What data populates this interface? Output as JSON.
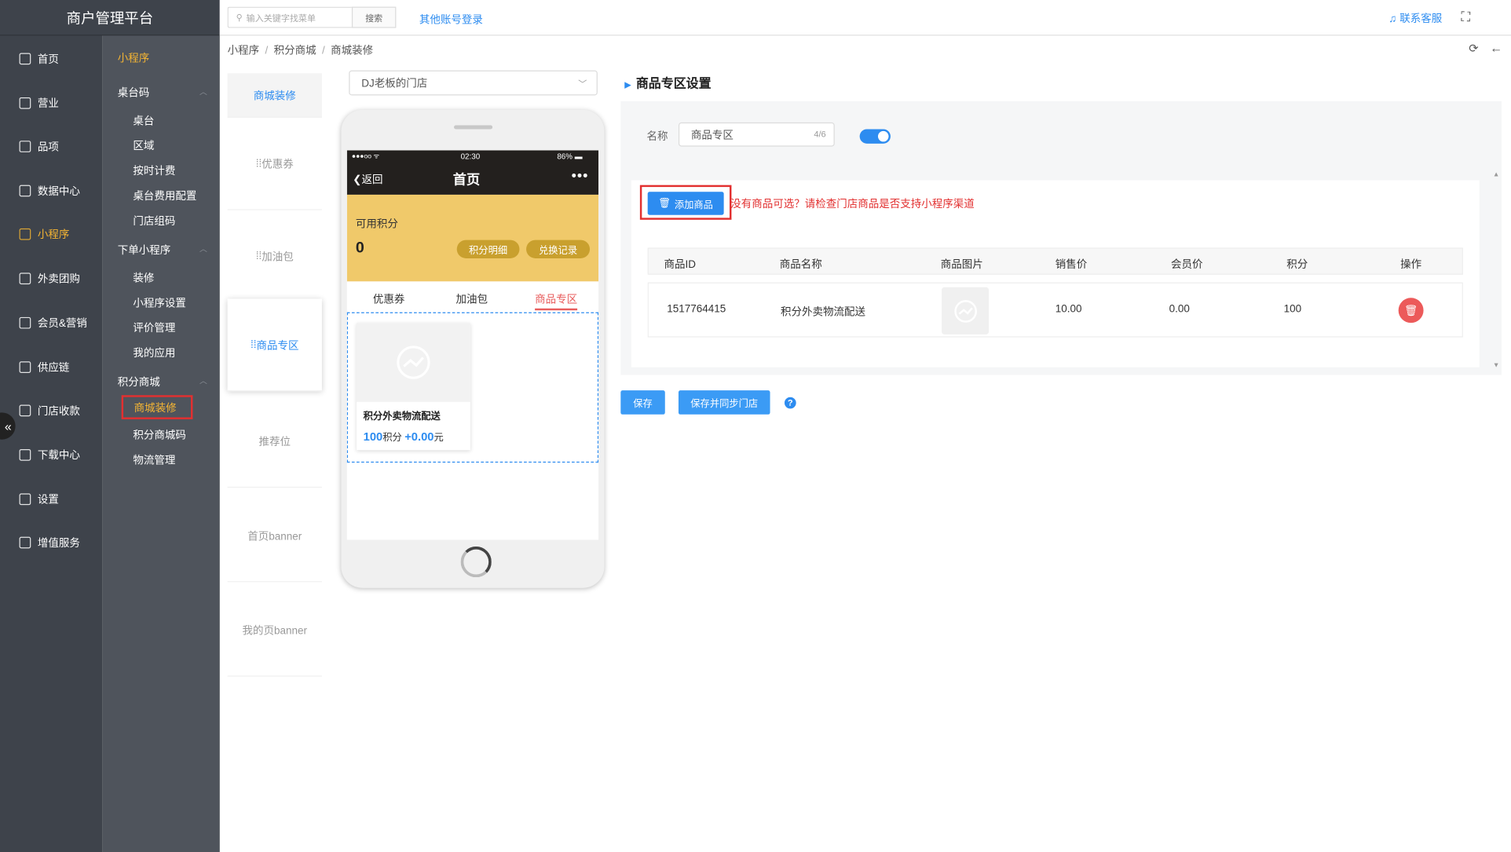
{
  "app": {
    "title": "商户管理平台"
  },
  "mainnav": {
    "items": [
      {
        "label": "首页",
        "icon": "home-icon"
      },
      {
        "label": "营业",
        "icon": "calendar-icon"
      },
      {
        "label": "品项",
        "icon": "bag-icon"
      },
      {
        "label": "数据中心",
        "icon": "share-icon"
      },
      {
        "label": "小程序",
        "icon": "phone-icon"
      },
      {
        "label": "外卖团购",
        "icon": "bike-icon"
      },
      {
        "label": "会员&营销",
        "icon": "user-icon"
      },
      {
        "label": "供应链",
        "icon": "truck-icon"
      },
      {
        "label": "门店收款",
        "icon": "coins-icon"
      },
      {
        "label": "下载中心",
        "icon": "download-icon"
      },
      {
        "label": "设置",
        "icon": "gear-icon"
      },
      {
        "label": "增值服务",
        "icon": "clock-icon"
      }
    ],
    "collapse": "«"
  },
  "subnav": {
    "title": "小程序",
    "groups": [
      {
        "label": "桌台码",
        "items": [
          "桌台",
          "区域",
          "按时计费",
          "桌台费用配置",
          "门店组码"
        ]
      },
      {
        "label": "下单小程序",
        "items": [
          "装修",
          "小程序设置",
          "评价管理",
          "我的应用"
        ]
      },
      {
        "label": "积分商城",
        "items": [
          "商城装修",
          "积分商城码",
          "物流管理"
        ]
      }
    ]
  },
  "topbar": {
    "search_placeholder": "输入关键字找菜单",
    "search_btn": "搜索",
    "other_login": "其他账号登录",
    "contact": "联系客服"
  },
  "breadcrumb": [
    "小程序",
    "积分商城",
    "商城装修"
  ],
  "deco_tabs": [
    "商城装修",
    "优惠券",
    "加油包",
    "商品专区",
    "推荐位",
    "首页banner",
    "我的页banner"
  ],
  "store_select": {
    "value": "DJ老板的门店"
  },
  "phone": {
    "status": {
      "signal": "●●●oo ᯤ",
      "time": "02:30",
      "battery": "86% ▬"
    },
    "nav": {
      "back": "返回",
      "title": "首页",
      "more": "•••"
    },
    "points": {
      "label": "可用积分",
      "value": "0",
      "btn_detail": "积分明细",
      "btn_record": "兑换记录"
    },
    "tabs": [
      "优惠券",
      "加油包",
      "商品专区"
    ],
    "product": {
      "name": "积分外卖物流配送",
      "points": "100",
      "points_unit": "积分",
      "plus": "+",
      "price": "0.00",
      "price_unit": "元"
    }
  },
  "settings": {
    "title": "商品专区设置",
    "name_label": "名称",
    "name_value": "商品专区",
    "name_count": "4/6",
    "toggle_on": true,
    "add_btn": "添加商品",
    "warning": "没有商品可选？请检查门店商品是否支持小程序渠道",
    "columns": [
      "商品ID",
      "商品名称",
      "商品图片",
      "销售价",
      "会员价",
      "积分",
      "操作"
    ],
    "rows": [
      {
        "id": "1517764415",
        "name": "积分外卖物流配送",
        "sale_price": "10.00",
        "member_price": "0.00",
        "points": "100"
      }
    ]
  },
  "actions": {
    "save": "保存",
    "save_sync": "保存并同步门店",
    "help": "?"
  },
  "colors": {
    "accent": "#2d8cf0",
    "active_nav": "#f5b533",
    "danger": "#e23030",
    "points_bg": "#f0c96a"
  }
}
